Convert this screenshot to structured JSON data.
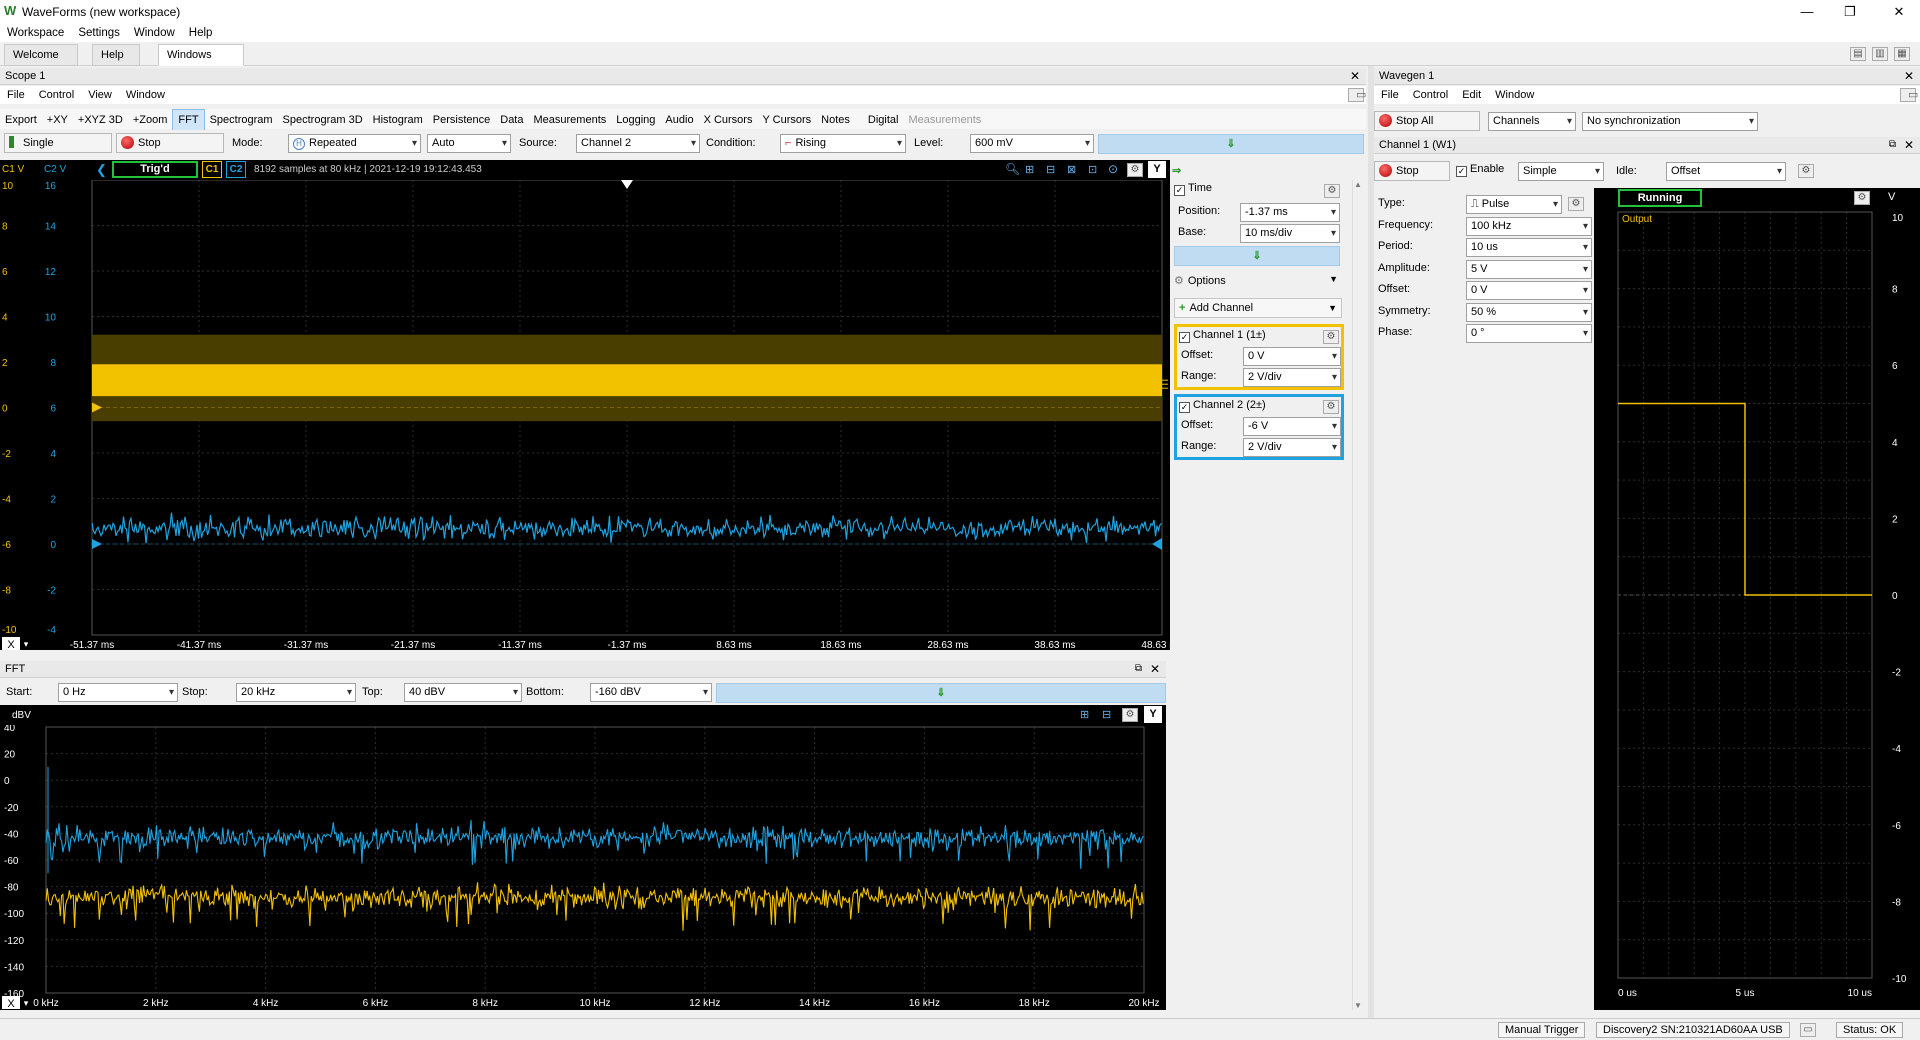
{
  "window": {
    "title": "WaveForms (new workspace)"
  },
  "menu": [
    "Workspace",
    "Settings",
    "Window",
    "Help"
  ],
  "tabs": [
    {
      "label": "Welcome"
    },
    {
      "label": "Help"
    },
    {
      "label": "Windows"
    }
  ],
  "scope": {
    "title": "Scope 1",
    "menu": [
      "File",
      "Control",
      "View",
      "Window"
    ],
    "toolbar": [
      "Export",
      "+XY",
      "+XYZ 3D",
      "+Zoom",
      "FFT",
      "Spectrogram",
      "Spectrogram 3D",
      "Histogram",
      "Persistence",
      "Data",
      "Measurements",
      "Logging",
      "Audio",
      "X Cursors",
      "Y Cursors",
      "Notes",
      "Digital",
      "Measurements"
    ],
    "single_label": "Single",
    "stop_label": "Stop",
    "mode_label": "Mode:",
    "mode_value": "Repeated",
    "auto_value": "Auto",
    "source_label": "Source:",
    "source_value": "Channel 2",
    "condition_label": "Condition:",
    "condition_value": "Rising",
    "level_label": "Level:",
    "level_value": "600 mV",
    "c1_axis_label": "C1 V",
    "c2_axis_label": "C2 V",
    "trig_status": "Trig'd",
    "c1_tag": "C1",
    "c2_tag": "C2",
    "info": "8192 samples at 80 kHz | 2021-12-19 19:12:43.453",
    "c1_ticks": [
      "10",
      "8",
      "6",
      "4",
      "2",
      "0",
      "-2",
      "-4",
      "-6",
      "-8",
      "-10"
    ],
    "c2_ticks": [
      "16",
      "14",
      "12",
      "10",
      "8",
      "6",
      "4",
      "2",
      "0",
      "-2",
      "-4"
    ],
    "x_ticks": [
      "-51.37 ms",
      "-41.37 ms",
      "-31.37 ms",
      "-21.37 ms",
      "-11.37 ms",
      "-1.37 ms",
      "8.63 ms",
      "18.63 ms",
      "28.63 ms",
      "38.63 ms",
      "48.63 ms"
    ],
    "x_btn": "X",
    "y_btn": "Y"
  },
  "side": {
    "time_label": "Time",
    "position_label": "Position:",
    "position_value": "-1.37 ms",
    "base_label": "Base:",
    "base_value": "10 ms/div",
    "options_label": "Options",
    "add_channel_label": "Add Channel",
    "ch1_label": "Channel 1 (1±)",
    "ch1_offset_label": "Offset:",
    "ch1_offset": "0 V",
    "ch1_range_label": "Range:",
    "ch1_range": "2 V/div",
    "ch2_label": "Channel 2 (2±)",
    "ch2_offset_label": "Offset:",
    "ch2_offset": "-6 V",
    "ch2_range_label": "Range:",
    "ch2_range": "2 V/div"
  },
  "fft": {
    "title": "FFT",
    "start_label": "Start:",
    "start_value": "0 Hz",
    "stop_label": "Stop:",
    "stop_value": "20 kHz",
    "top_label": "Top:",
    "top_value": "40 dBV",
    "bottom_label": "Bottom:",
    "bottom_value": "-160 dBV",
    "y_unit": "dBV",
    "y_ticks": [
      "40",
      "20",
      "0",
      "-20",
      "-40",
      "-60",
      "-80",
      "-100",
      "-120",
      "-140",
      "-160"
    ],
    "x_ticks": [
      "0 kHz",
      "2 kHz",
      "4 kHz",
      "6 kHz",
      "8 kHz",
      "10 kHz",
      "12 kHz",
      "14 kHz",
      "16 kHz",
      "18 kHz",
      "20 kHz"
    ],
    "x_btn": "X",
    "y_btn": "Y"
  },
  "wavegen": {
    "title": "Wavegen 1",
    "menu": [
      "File",
      "Control",
      "Edit",
      "Window"
    ],
    "stop_all_label": "Stop All",
    "channels_value": "Channels",
    "sync_value": "No synchronization",
    "channel_title": "Channel 1 (W1)",
    "stop_label": "Stop",
    "enable_label": "Enable",
    "mode_value": "Simple",
    "idle_label": "Idle:",
    "idle_value": "Offset",
    "params": [
      {
        "label": "Type:",
        "value": "Pulse"
      },
      {
        "label": "Frequency:",
        "value": "100 kHz"
      },
      {
        "label": "Period:",
        "value": "10 us"
      },
      {
        "label": "Amplitude:",
        "value": "5 V"
      },
      {
        "label": "Offset:",
        "value": "0 V"
      },
      {
        "label": "Symmetry:",
        "value": "50 %"
      },
      {
        "label": "Phase:",
        "value": "0 °"
      }
    ],
    "running_label": "Running",
    "output_label": "Output",
    "unit": "V",
    "y_ticks": [
      "10",
      "8",
      "6",
      "4",
      "2",
      "0",
      "-2",
      "-4",
      "-6",
      "-8",
      "-10"
    ],
    "x_ticks": [
      "0 us",
      "5 us",
      "10 us"
    ]
  },
  "status": {
    "manual_trigger": "Manual Trigger",
    "device": "Discovery2 SN:210321AD60AA USB",
    "status": "Status: OK"
  },
  "colors": {
    "ch1": "#f2c200",
    "ch2": "#1fa3e0",
    "grid": "#3a3a3a",
    "accent_green": "#22c33a"
  }
}
